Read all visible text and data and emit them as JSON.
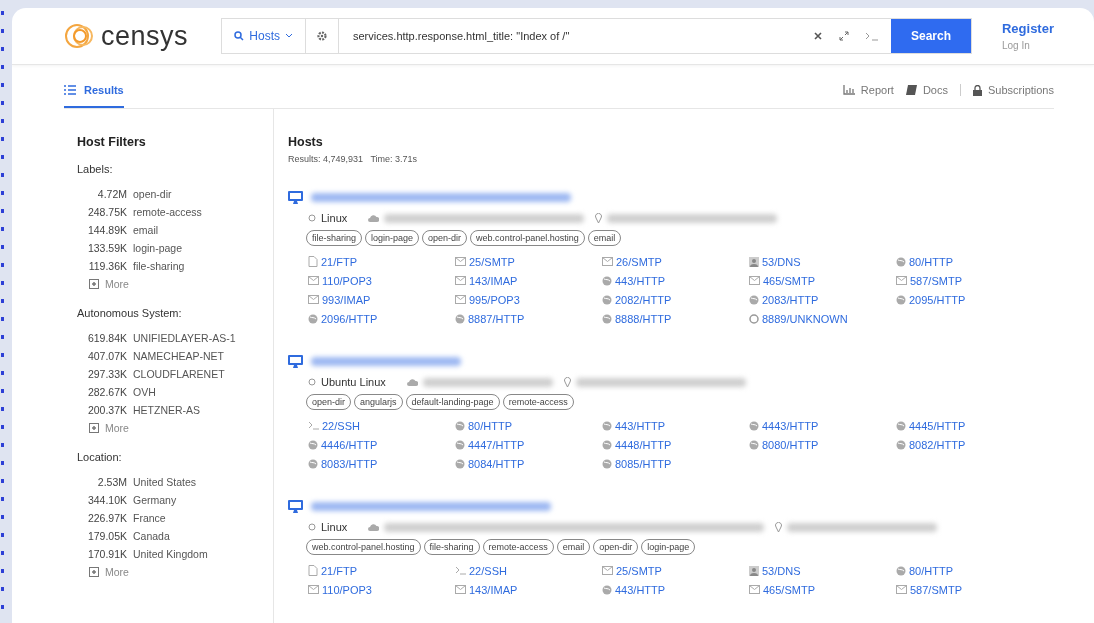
{
  "header": {
    "logo": "censys",
    "search_type": "Hosts",
    "query": "services.http.response.html_title: \"Index of /\"",
    "search_button": "Search",
    "register": "Register",
    "login": "Log In"
  },
  "nav": {
    "tabs": [
      {
        "label": "Results",
        "selected": true
      }
    ],
    "links": [
      {
        "label": "Report",
        "kind": "chart"
      },
      {
        "label": "Docs",
        "kind": "book"
      },
      {
        "label": "Subscriptions",
        "kind": "lock"
      }
    ]
  },
  "filters": {
    "title": "Host Filters",
    "groups": [
      {
        "title": "Labels:",
        "items": [
          {
            "count": "4.72M",
            "label": "open-dir"
          },
          {
            "count": "248.75K",
            "label": "remote-access"
          },
          {
            "count": "144.89K",
            "label": "email"
          },
          {
            "count": "133.59K",
            "label": "login-page"
          },
          {
            "count": "119.36K",
            "label": "file-sharing"
          }
        ],
        "more": "More"
      },
      {
        "title": "Autonomous System:",
        "items": [
          {
            "count": "619.84K",
            "label": "UNIFIEDLAYER-AS-1"
          },
          {
            "count": "407.07K",
            "label": "NAMECHEAP-NET"
          },
          {
            "count": "297.33K",
            "label": "CLOUDFLARENET"
          },
          {
            "count": "282.67K",
            "label": "OVH"
          },
          {
            "count": "200.37K",
            "label": "HETZNER-AS"
          }
        ],
        "more": "More"
      },
      {
        "title": "Location:",
        "items": [
          {
            "count": "2.53M",
            "label": "United States"
          },
          {
            "count": "344.10K",
            "label": "Germany"
          },
          {
            "count": "226.97K",
            "label": "France"
          },
          {
            "count": "179.05K",
            "label": "Canada"
          },
          {
            "count": "170.91K",
            "label": "United Kingdom"
          }
        ],
        "more": "More"
      }
    ]
  },
  "results": {
    "title": "Hosts",
    "summary": "Results: 4,749,931   Time: 3.71s",
    "hosts": [
      {
        "os": "Linux",
        "labels": [
          "file-sharing",
          "login-page",
          "open-dir",
          "web.control-panel.hosting",
          "email"
        ],
        "ports": [
          {
            "label": "21/FTP",
            "kind": "file"
          },
          {
            "label": "25/SMTP",
            "kind": "mail"
          },
          {
            "label": "26/SMTP",
            "kind": "mail"
          },
          {
            "label": "53/DNS",
            "kind": "dns"
          },
          {
            "label": "80/HTTP",
            "kind": "globe"
          },
          {
            "label": "110/POP3",
            "kind": "mail"
          },
          {
            "label": "143/IMAP",
            "kind": "mail"
          },
          {
            "label": "443/HTTP",
            "kind": "globe"
          },
          {
            "label": "465/SMTP",
            "kind": "mail"
          },
          {
            "label": "587/SMTP",
            "kind": "mail"
          },
          {
            "label": "993/IMAP",
            "kind": "mail"
          },
          {
            "label": "995/POP3",
            "kind": "mail"
          },
          {
            "label": "2082/HTTP",
            "kind": "globe"
          },
          {
            "label": "2083/HTTP",
            "kind": "globe"
          },
          {
            "label": "2095/HTTP",
            "kind": "globe"
          },
          {
            "label": "2096/HTTP",
            "kind": "globe"
          },
          {
            "label": "8887/HTTP",
            "kind": "globe"
          },
          {
            "label": "8888/HTTP",
            "kind": "globe"
          },
          {
            "label": "8889/UNKNOWN",
            "kind": "unknown"
          }
        ]
      },
      {
        "os": "Ubuntu Linux",
        "labels": [
          "open-dir",
          "angularjs",
          "default-landing-page",
          "remote-access"
        ],
        "ports": [
          {
            "label": "22/SSH",
            "kind": "terminal"
          },
          {
            "label": "80/HTTP",
            "kind": "globe"
          },
          {
            "label": "443/HTTP",
            "kind": "globe"
          },
          {
            "label": "4443/HTTP",
            "kind": "globe"
          },
          {
            "label": "4445/HTTP",
            "kind": "globe"
          },
          {
            "label": "4446/HTTP",
            "kind": "globe"
          },
          {
            "label": "4447/HTTP",
            "kind": "globe"
          },
          {
            "label": "4448/HTTP",
            "kind": "globe"
          },
          {
            "label": "8080/HTTP",
            "kind": "globe"
          },
          {
            "label": "8082/HTTP",
            "kind": "globe"
          },
          {
            "label": "8083/HTTP",
            "kind": "globe"
          },
          {
            "label": "8084/HTTP",
            "kind": "globe"
          },
          {
            "label": "8085/HTTP",
            "kind": "globe"
          }
        ]
      },
      {
        "os": "Linux",
        "labels": [
          "web.control-panel.hosting",
          "file-sharing",
          "remote-access",
          "email",
          "open-dir",
          "login-page"
        ],
        "ports": [
          {
            "label": "21/FTP",
            "kind": "file"
          },
          {
            "label": "22/SSH",
            "kind": "terminal"
          },
          {
            "label": "25/SMTP",
            "kind": "mail"
          },
          {
            "label": "53/DNS",
            "kind": "dns"
          },
          {
            "label": "80/HTTP",
            "kind": "globe"
          },
          {
            "label": "110/POP3",
            "kind": "mail"
          },
          {
            "label": "143/IMAP",
            "kind": "mail"
          },
          {
            "label": "443/HTTP",
            "kind": "globe"
          },
          {
            "label": "465/SMTP",
            "kind": "mail"
          },
          {
            "label": "587/SMTP",
            "kind": "mail"
          }
        ]
      }
    ]
  }
}
